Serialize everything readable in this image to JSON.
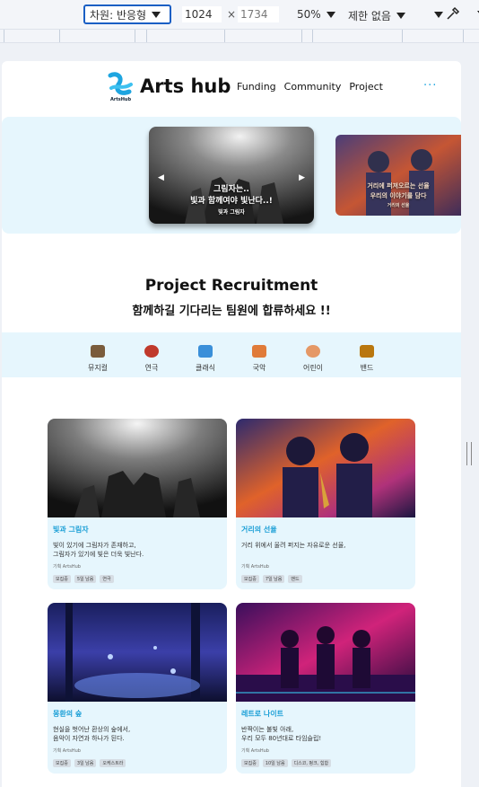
{
  "devtools": {
    "dimension_label": "차원: 반응형",
    "width_value": "1024",
    "times": "×",
    "height_placeholder": "1734",
    "zoom": "50%",
    "throttle": "제한 없음"
  },
  "header": {
    "logo_small": "ArtsHub",
    "brand": "Arts hub",
    "nav": [
      "Funding",
      "Community",
      "Project"
    ],
    "more": "···"
  },
  "banner": {
    "main_line1": "그림자는..",
    "main_line2": "빛과 함께여야 빛난다..!",
    "main_line3": "빛과 그림자",
    "side_line1": "거리에 퍼져오르는 선율",
    "side_line2": "우리의 이야기를 담다",
    "side_line3": "거리의 선율",
    "prev": "◀",
    "next": "▶"
  },
  "section": {
    "title": "Project Recruitment",
    "subtitle": "함께하길 기다리는 팀원에 합류하세요 !!"
  },
  "categories": [
    {
      "label": "뮤지컬",
      "icon": "piano-icon",
      "color": "#7a5c3c"
    },
    {
      "label": "연극",
      "icon": "theater-icon",
      "color": "#c0392b"
    },
    {
      "label": "클래식",
      "icon": "violin-icon",
      "color": "#3a8fd9"
    },
    {
      "label": "국악",
      "icon": "hourglass-icon",
      "color": "#e07b39"
    },
    {
      "label": "어린이",
      "icon": "child-icon",
      "color": "#e59866"
    },
    {
      "label": "밴드",
      "icon": "guitar-icon",
      "color": "#b9770e"
    }
  ],
  "cards": [
    {
      "title": "빛과 그림자",
      "desc1": "빛이 있기에 그림자가 존재하고,",
      "desc2": "그림자가 있기에 빛은 더욱 빛난다.",
      "org": "기획 ArtsHub",
      "tags": [
        "모집중",
        "5일 남음",
        "연극"
      ]
    },
    {
      "title": "거리의 선율",
      "desc1": "거리 위에서 울려 퍼지는 자유로운 선율,",
      "desc2": "",
      "org": "기획 ArtsHub",
      "tags": [
        "모집중",
        "7일 남음",
        "밴드"
      ]
    },
    {
      "title": "몽환의 숲",
      "desc1": "현실을 벗어난 환상의 숲에서,",
      "desc2": "음악이 자연과 하나가 된다.",
      "org": "기획 ArtsHub",
      "tags": [
        "모집중",
        "3일 남음",
        "오케스트라"
      ]
    },
    {
      "title": "레트로 나이트",
      "desc1": "반짝이는 불빛 아래,",
      "desc2": "우리 모두 80년대로 타임슬립!",
      "org": "기획 ArtsHub",
      "tags": [
        "모집중",
        "10일 남음",
        "디스코, 펑크, 힙합"
      ]
    }
  ],
  "colors": {
    "accent": "#1ea5e0",
    "panel": "#e6f6fd"
  }
}
